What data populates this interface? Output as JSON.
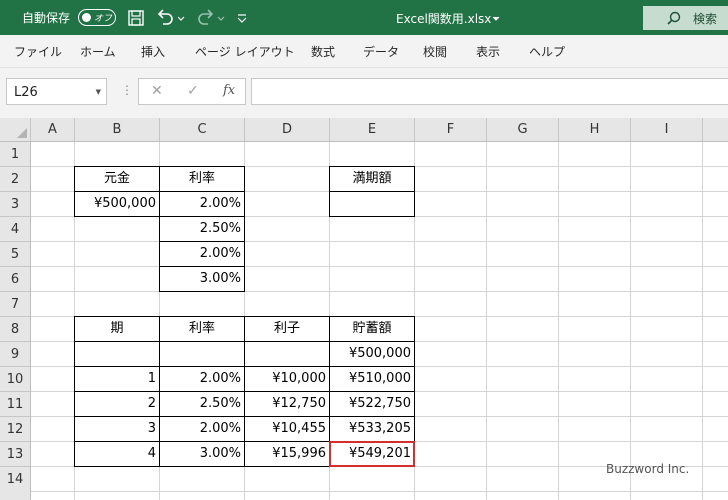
{
  "titlebar": {
    "autosave_label": "自動保存",
    "toggle_state": "オフ",
    "filename": "Excel関数用.xlsx",
    "search_label": "検索"
  },
  "ribbon": [
    "ファイル",
    "ホーム",
    "挿入",
    "ページ レイアウト",
    "数式",
    "データ",
    "校閲",
    "表示",
    "ヘルプ"
  ],
  "namebox": "L26",
  "formula": "",
  "columns": [
    "A",
    "B",
    "C",
    "D",
    "E",
    "F",
    "G",
    "H",
    "I"
  ],
  "rows": [
    "1",
    "2",
    "3",
    "4",
    "5",
    "6",
    "7",
    "8",
    "9",
    "10",
    "11",
    "12",
    "13",
    "14"
  ],
  "table1": {
    "header_principal": "元金",
    "header_rate": "利率",
    "principal": "¥500,000",
    "rates": [
      "2.00%",
      "2.50%",
      "2.00%",
      "3.00%"
    ]
  },
  "maturity": {
    "header": "満期額",
    "value": ""
  },
  "table2": {
    "headers": [
      "期",
      "利率",
      "利子",
      "貯蓄額"
    ],
    "rows": [
      [
        "",
        "",
        "",
        "¥500,000"
      ],
      [
        "1",
        "2.00%",
        "¥10,000",
        "¥510,000"
      ],
      [
        "2",
        "2.50%",
        "¥12,750",
        "¥522,750"
      ],
      [
        "3",
        "2.00%",
        "¥10,455",
        "¥533,205"
      ],
      [
        "4",
        "3.00%",
        "¥15,996",
        "¥549,201"
      ]
    ]
  },
  "watermark": "Buzzword Inc."
}
